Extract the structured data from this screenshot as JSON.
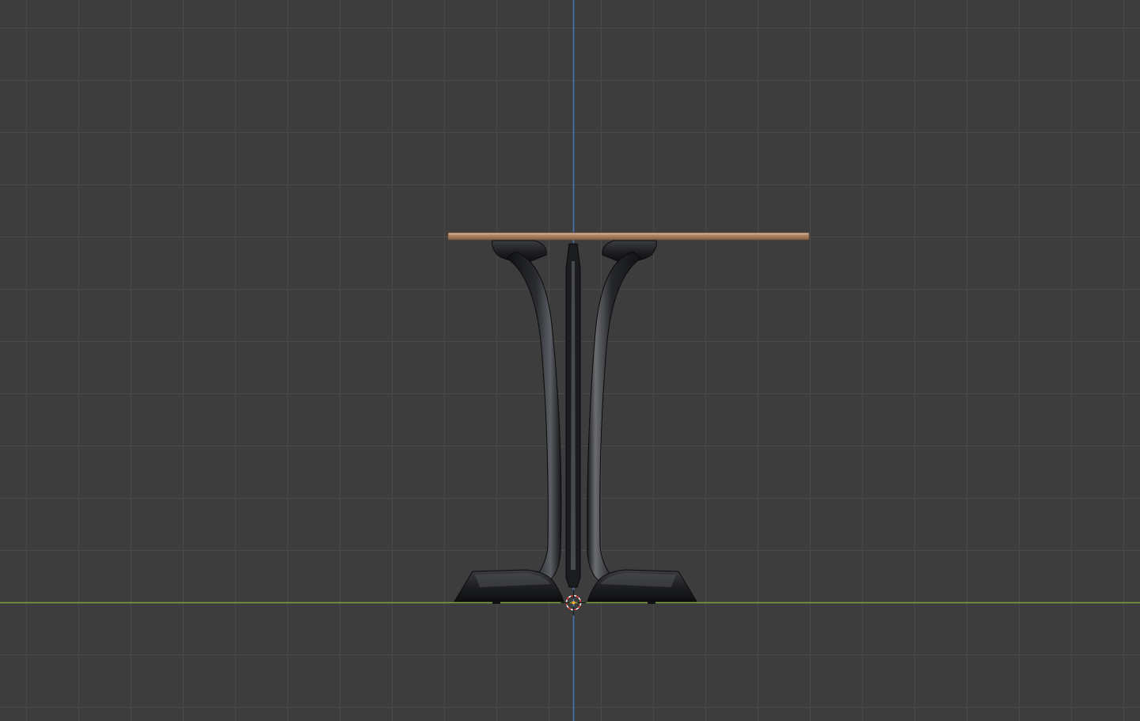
{
  "viewport": {
    "view": "orthographic-front",
    "background_color": "#3d3d3d",
    "grid_color": "#4a4a4a",
    "axis_z_color": "#4a76b8",
    "axis_x_color": "#7aa33a",
    "icons": [
      "3d-cursor-icon"
    ]
  },
  "scene": {
    "objects": [
      {
        "name": "table-top",
        "material_color": "#b48e6d"
      },
      {
        "name": "table-base",
        "material_color": "#1c1d20"
      }
    ]
  }
}
